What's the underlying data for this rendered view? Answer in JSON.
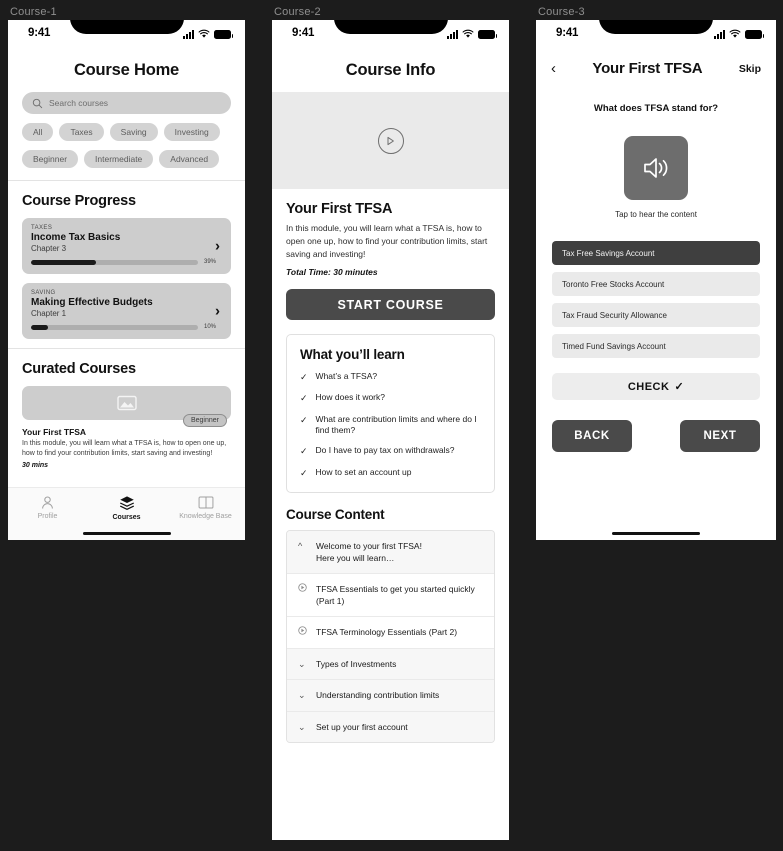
{
  "frames": [
    {
      "label": "Course-1"
    },
    {
      "label": "Course-2"
    },
    {
      "label": "Course-3"
    }
  ],
  "status_bar": {
    "time": "9:41"
  },
  "course_home": {
    "nav_title": "Course Home",
    "search": {
      "placeholder": "Search courses",
      "icon": "search-icon"
    },
    "filter_chips": [
      "All",
      "Taxes",
      "Saving",
      "Investing"
    ],
    "level_chips": [
      "Beginner",
      "Intermediate",
      "Advanced"
    ],
    "progress_section_title": "Course Progress",
    "progress_cards": [
      {
        "category": "TAXES",
        "title": "Income Tax Basics",
        "chapter": "Chapter 3",
        "percent": "39%",
        "percent_value": 39
      },
      {
        "category": "SAVING",
        "title": "Making Effective Budgets",
        "chapter": "Chapter 1",
        "percent": "10%",
        "percent_value": 10
      }
    ],
    "curated_section_title": "Curated Courses",
    "curated_card": {
      "image_placeholder_icon": "image-icon",
      "badge": "Beginner",
      "title": "Your First TFSA",
      "description": "In this module, you will learn what a TFSA is, how to open one up, how to find your contribution limits, start saving and investing!",
      "duration": "30 mins"
    },
    "expand_icon": "chevron-down-icon",
    "tabs": [
      {
        "label": "Profile",
        "icon": "person-icon",
        "active": false
      },
      {
        "label": "Courses",
        "icon": "layers-icon",
        "active": true
      },
      {
        "label": "Knowledge Base",
        "icon": "book-icon",
        "active": false
      }
    ]
  },
  "course_info": {
    "nav_title": "Course Info",
    "hero": {
      "icon": "play-icon"
    },
    "title": "Your First TFSA",
    "description": "In this module, you will learn what a TFSA is, how to open one up, how to find your contribution limits, start saving and investing!",
    "total_time": "Total Time: 30 minutes",
    "cta_label": "START COURSE",
    "learn_panel_title": "What you’ll learn",
    "learn_items": [
      "What’s a TFSA?",
      "How does it work?",
      "What are contribution limits and where do I find them?",
      "Do I have to pay tax on withdrawals?",
      "How to set an account up"
    ],
    "content_title": "Course Content",
    "content_rows": [
      {
        "type": "header",
        "icon": "chevron-up-icon",
        "line1": "Welcome to your first TFSA!",
        "line2": "Here you will learn…"
      },
      {
        "type": "lesson",
        "icon": "play-circle-icon",
        "line1": "TFSA Essentials to get you started quickly (Part 1)"
      },
      {
        "type": "lesson",
        "icon": "play-circle-icon",
        "line1": "TFSA Terminology Essentials (Part 2)"
      },
      {
        "type": "header",
        "icon": "chevron-down-icon",
        "line1": "Types of Investments"
      },
      {
        "type": "header",
        "icon": "chevron-down-icon",
        "line1": "Understanding contribution limits"
      },
      {
        "type": "header",
        "icon": "chevron-down-icon",
        "line1": "Set up your first account"
      }
    ]
  },
  "quiz": {
    "back_icon": "chevron-left-icon",
    "nav_title": "Your First TFSA",
    "skip_label": "Skip",
    "question": "What does TFSA stand for?",
    "audio": {
      "icon": "speaker-icon",
      "hint": "Tap to hear the content"
    },
    "options": [
      {
        "label": "Tax Free Savings Account",
        "selected": true
      },
      {
        "label": "Toronto Free Stocks Account",
        "selected": false
      },
      {
        "label": "Tax Fraud Security Allowance",
        "selected": false
      },
      {
        "label": "Timed Fund Savings Account",
        "selected": false
      }
    ],
    "check_label": "CHECK",
    "check_icon": "checkmark-icon",
    "back_label": "BACK",
    "next_label": "NEXT"
  },
  "colors": {
    "canvas": "#1c1c1c",
    "chip_bg": "#d3d3d3",
    "card_bg": "#cdcdcd",
    "dark_button": "#4a4a4a",
    "selected_option": "#3f3f3f",
    "option_bg": "#eaeaea",
    "text_primary": "#111111"
  }
}
